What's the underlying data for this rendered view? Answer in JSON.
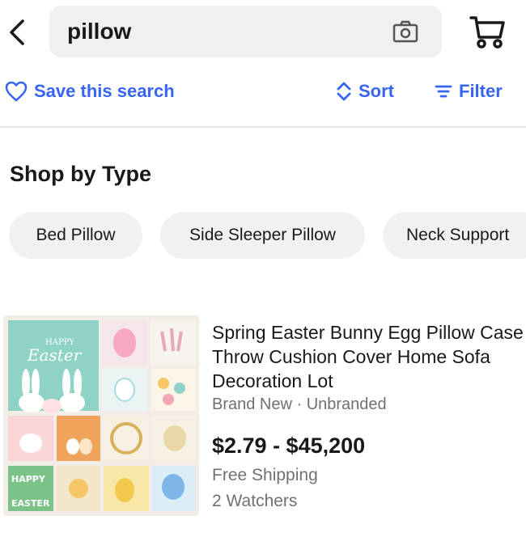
{
  "search": {
    "query": "pillow"
  },
  "actions": {
    "save_label": "Save this search",
    "sort_label": "Sort",
    "filter_label": "Filter"
  },
  "shop_by_type": {
    "title": "Shop by Type",
    "chips": [
      "Bed Pillow",
      "Side Sleeper Pillow",
      "Neck Support"
    ]
  },
  "listing": {
    "title": "Spring Easter Bunny Egg Pillow Case Throw Cushion Cover Home Sofa Decoration Lot",
    "condition": "Brand New · Unbranded",
    "price": "$2.79 - $45,200",
    "shipping": "Free Shipping",
    "watchers": "2 Watchers",
    "image_text": {
      "tile1_line1": "HAPPY",
      "tile1_line2": "Easter",
      "tile_happy": "HAPPY",
      "tile_easter": "EASTER"
    }
  },
  "colors": {
    "accent": "#3665f3",
    "text": "#191919",
    "secondary": "#707070",
    "chip_bg": "#f1f1f1",
    "search_bg": "#f0f0f2"
  },
  "icons": {
    "back": "chevron-left-icon",
    "camera": "camera-icon",
    "cart": "cart-icon",
    "heart": "heart-icon",
    "sort": "sort-icon",
    "filter": "filter-icon"
  }
}
